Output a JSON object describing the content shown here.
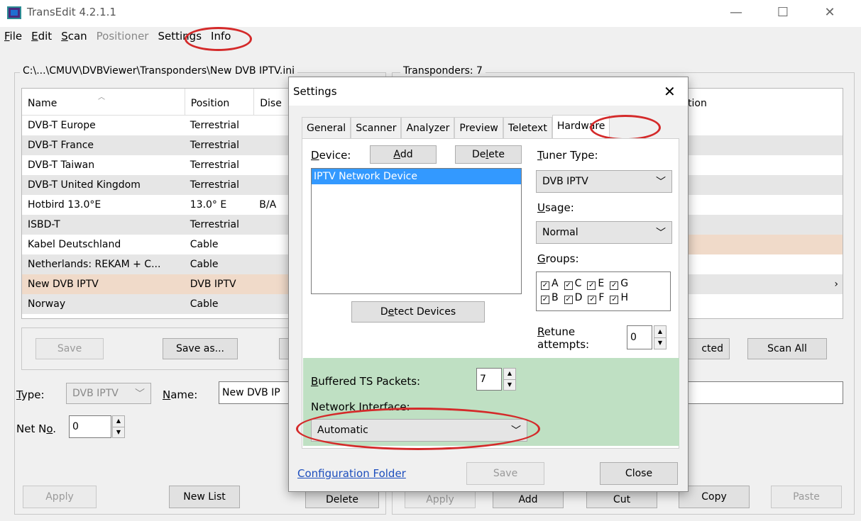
{
  "window": {
    "title": "TransEdit 4.2.1.1",
    "minimize": "—",
    "maximize": "☐",
    "close": "✕"
  },
  "menu": [
    {
      "label": "File",
      "u": "F",
      "rest": "ile"
    },
    {
      "label": "Edit",
      "u": "E",
      "rest": "dit"
    },
    {
      "label": "Scan",
      "u": "S",
      "rest": "can"
    },
    {
      "label": "Positioner"
    },
    {
      "label": "Settings"
    },
    {
      "label": "Info"
    }
  ],
  "left": {
    "group_label": "C:\\...\\CMUV\\DVBViewer\\Transponders\\New DVB IPTV.ini",
    "columns": [
      "Name",
      "Position",
      "Dise"
    ],
    "rows": [
      [
        "DVB-T Europe",
        "Terrestrial",
        ""
      ],
      [
        "DVB-T France",
        "Terrestrial",
        ""
      ],
      [
        "DVB-T Taiwan",
        "Terrestrial",
        ""
      ],
      [
        "DVB-T United Kingdom",
        "Terrestrial",
        ""
      ],
      [
        "Hotbird 13.0°E",
        "13.0° E",
        "B/A"
      ],
      [
        "ISBD-T",
        "Terrestrial",
        ""
      ],
      [
        "Kabel Deutschland",
        "Cable",
        ""
      ],
      [
        "Netherlands: REKAM + C...",
        "Cable",
        ""
      ],
      [
        "New DVB IPTV",
        "DVB IPTV",
        ""
      ],
      [
        "Norway",
        "Cable",
        ""
      ]
    ],
    "save": "Save",
    "save_as": "Save as...",
    "type_label": "Type:",
    "type_value": "DVB IPTV",
    "name_label": "Name:",
    "name_value": "New DVB IP",
    "netno_label": "Net No.",
    "netno_value": "0",
    "apply": "Apply",
    "new_list": "New List",
    "delete": "Delete"
  },
  "right": {
    "group_label": "Transponders: 7",
    "col_partial": "tion",
    "selected_partial": "cted",
    "scan_all": "Scan All",
    "apply": "Apply",
    "add": "Add",
    "cut": "Cut",
    "copy": "Copy",
    "paste": "Paste"
  },
  "dialog": {
    "title": "Settings",
    "close": "✕",
    "tabs": [
      "General",
      "Scanner",
      "Analyzer",
      "Preview",
      "Teletext",
      "Hardware"
    ],
    "device_label": "Device:",
    "add": "Add",
    "delete": "Delete",
    "devices": [
      "IPTV Network Device"
    ],
    "detect": "Detect Devices",
    "tuner_type_label": "Tuner Type:",
    "tuner_type": "DVB IPTV",
    "usage_label": "Usage:",
    "usage": "Normal",
    "groups_label": "Groups:",
    "groups_row1": [
      "A",
      "C",
      "E",
      "G"
    ],
    "groups_row2": [
      "B",
      "D",
      "F",
      "H"
    ],
    "retune_label": "Retune",
    "retune_label2": "attempts:",
    "retune_value": "0",
    "buffered_label": "Buffered TS Packets:",
    "buffered_value": "7",
    "net_iface_label": "Network Interface:",
    "net_iface_value": "Automatic",
    "config_folder": "Configuration Folder",
    "save": "Save",
    "close_btn": "Close"
  },
  "colors": {
    "highlight_row": "#f0dac9",
    "green_panel": "#bfe0c3",
    "selection": "#3399ff",
    "annotation": "#d42a2a"
  }
}
